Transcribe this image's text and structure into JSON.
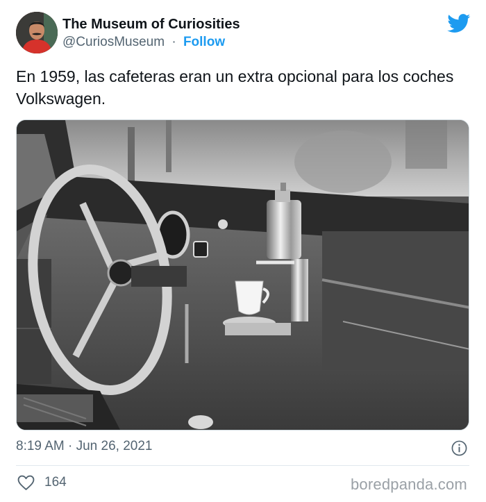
{
  "author": {
    "name": "The Museum of Curiosities",
    "handle": "@CuriosMuseum",
    "separator": "·",
    "follow_label": "Follow"
  },
  "tweet": {
    "text": "En 1959, las cafeteras eran un extra opcional para los coches Volkswagen.",
    "timestamp": "8:19 AM · Jun 26, 2021",
    "likes": "164"
  },
  "icons": {
    "brand": "twitter-bird-icon",
    "info": "info-icon",
    "like": "heart-icon"
  },
  "watermark": "boredpanda.com",
  "colors": {
    "accent": "#1d9bf0",
    "text": "#0f1419",
    "muted": "#536471"
  }
}
